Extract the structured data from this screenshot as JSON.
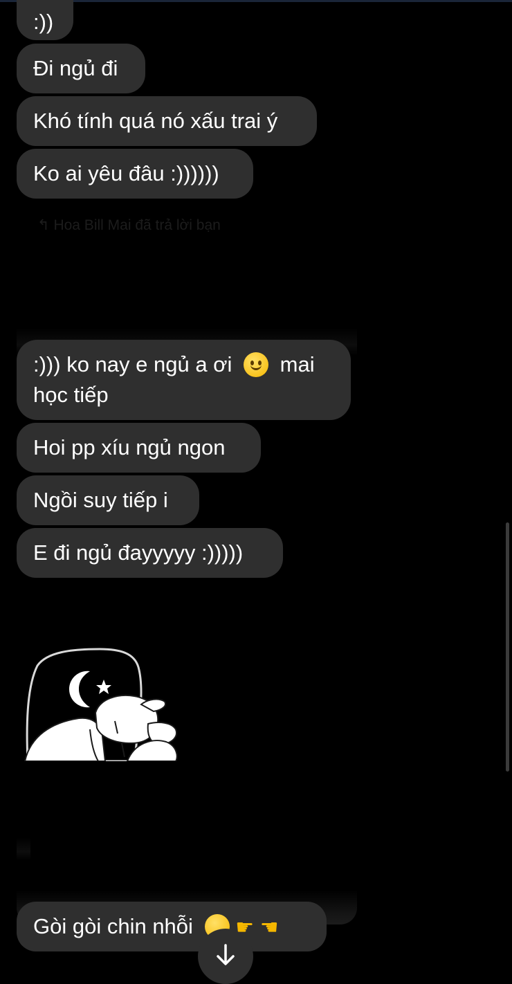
{
  "messages": [
    {
      "id": "m1",
      "text": ":))"
    },
    {
      "id": "m2",
      "text": "Đi ngủ đi"
    },
    {
      "id": "m3",
      "text": "Khó tính quá nó xấu trai ý"
    },
    {
      "id": "m4",
      "text": "Ko ai yêu đâu :))))))"
    },
    {
      "id": "m5",
      "text_before": ":))) ko nay e ngủ a ơi",
      "text_after": "mai",
      "text_line2": "học tiếp",
      "emoji": "slightly-smiling-face-icon"
    },
    {
      "id": "m6",
      "text": "Hoi pp xíu ngủ ngon"
    },
    {
      "id": "m7",
      "text": "Ngồi suy tiếp i"
    },
    {
      "id": "m8",
      "text": "E đi ngủ đayyyyy :)))))"
    },
    {
      "id": "m9",
      "text": "Gòi gòi chin nhỗi",
      "emojis": [
        "shy-face-icon",
        "pointing-right-icon",
        "pointing-left-icon"
      ]
    }
  ],
  "reply_indicator": {
    "text": "Hoa Bill Mai đã trả lời bạn",
    "icon": "reply-arrow-icon"
  },
  "sticker": {
    "icon": "sleeping-on-moon-sticker"
  },
  "scroll_down": {
    "icon": "arrow-down-icon"
  },
  "colors": {
    "background": "#000000",
    "bubble": "#2f2f2f",
    "text": "#ffffff"
  }
}
